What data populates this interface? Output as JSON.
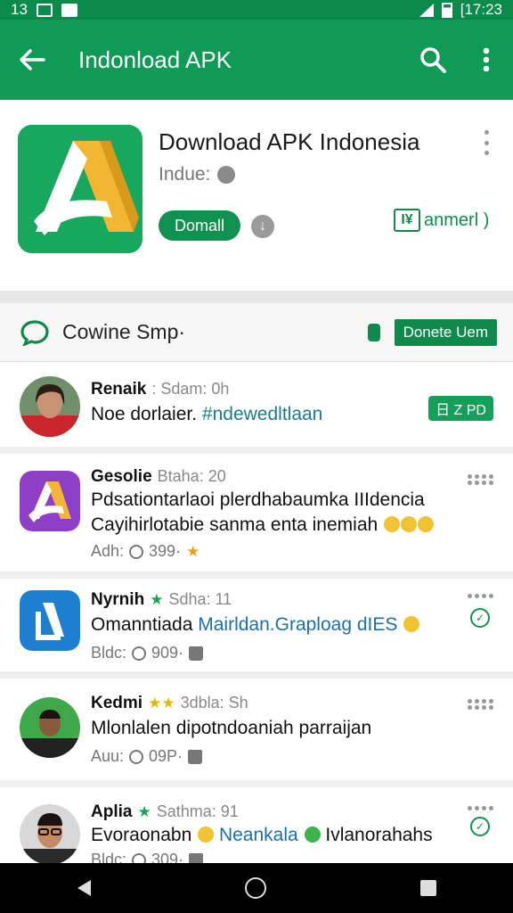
{
  "status_bar": {
    "left_text": "13",
    "time": "[17:23"
  },
  "app_bar": {
    "title": "Indonload APK"
  },
  "app_card": {
    "name": "Download APK Indonesia",
    "developer": "Indue:",
    "install_label": "Domall",
    "verified_label": "anmerl )",
    "verified_icon_text": "I¥",
    "info_glyph": "↓"
  },
  "community": {
    "title": "Cowine Smp·",
    "button_label": "Donete Uem"
  },
  "posts": [
    {
      "name": "Renaik",
      "meta": ": Sdam: 0h",
      "text_plain": "Noe dorlaier. ",
      "text_hashtag": "#ndewedltlaan",
      "badge": "日 Z PD"
    },
    {
      "name": "Gesolie",
      "meta": "Btaha: 20",
      "line1": "Pdsationtarlaoi plerdhabaumka IIIdencia",
      "line2": "Cayihirlotabie sanma enta inemiah",
      "foot_label": "Adh:",
      "foot_count": "399·"
    },
    {
      "name": "Nyrnih",
      "meta": "Sdha: 11",
      "text_plain": "Omanntiada ",
      "text_link": "Mairldan.Graploag dIES",
      "foot_label": "Bldc:",
      "foot_count": "909·"
    },
    {
      "name": "Kedmi",
      "meta": "3dbla: Sh",
      "text": "Mlonlalen dipotndoaniah parraijan",
      "foot_label": "Auu:",
      "foot_count": "09P·"
    },
    {
      "name": "Aplia",
      "meta": "Sathma: 91",
      "text_a": "Evoraonabn ",
      "text_b": "Neankala",
      "text_c": "Ivlanorahahs",
      "foot_label": "Bldc:",
      "foot_count": "309·"
    }
  ],
  "colors": {
    "primary": "#0f9a55",
    "primary_dark": "#0a8a4b",
    "accent_gold": "#f2b632"
  }
}
